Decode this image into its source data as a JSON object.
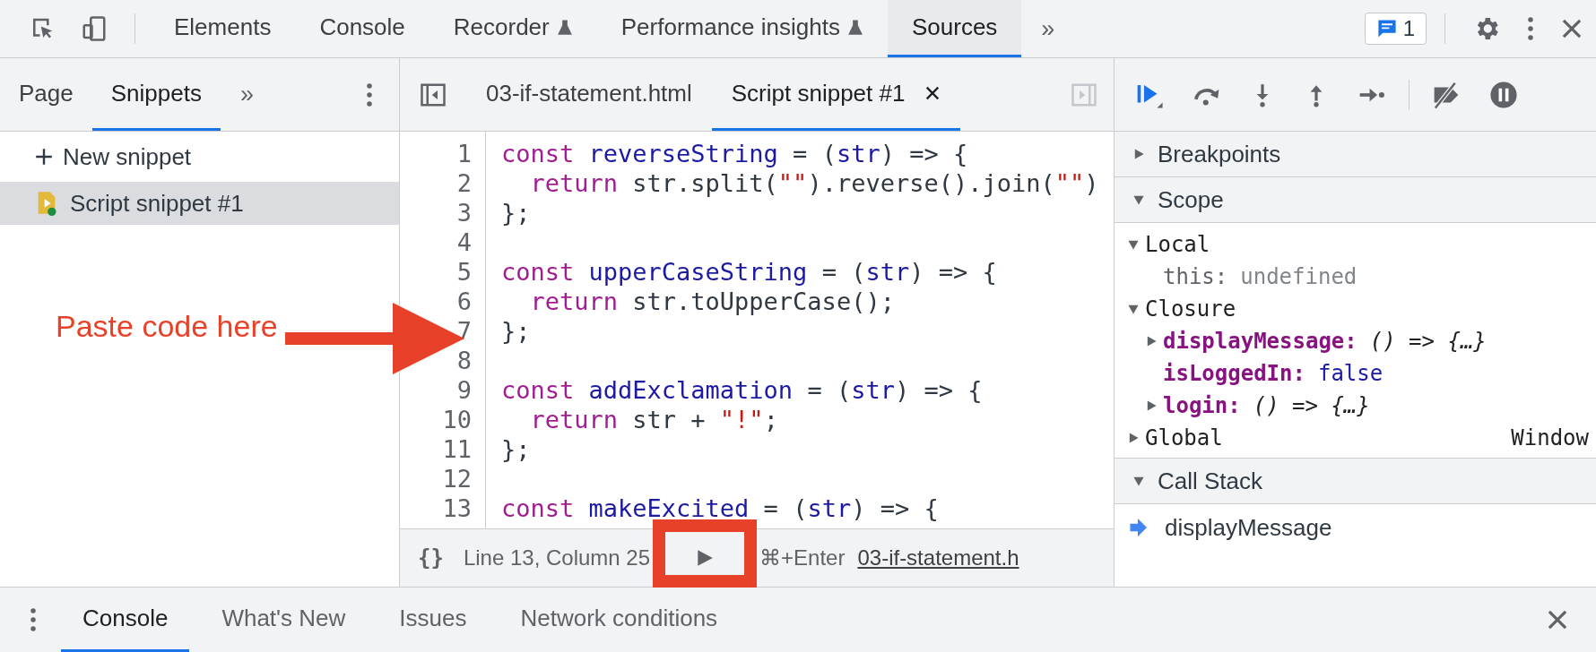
{
  "toolbar": {
    "tabs": [
      {
        "label": "Elements",
        "selected": false,
        "experimental": false
      },
      {
        "label": "Console",
        "selected": false,
        "experimental": false
      },
      {
        "label": "Recorder",
        "selected": false,
        "experimental": true
      },
      {
        "label": "Performance insights",
        "selected": false,
        "experimental": true
      },
      {
        "label": "Sources",
        "selected": true,
        "experimental": false
      }
    ],
    "more": "»",
    "issues_count": "1"
  },
  "navigator": {
    "tabs": [
      {
        "label": "Page",
        "selected": false
      },
      {
        "label": "Snippets",
        "selected": true
      }
    ],
    "more": "»",
    "new_snippet": "New snippet",
    "items": [
      {
        "label": "Script snippet #1",
        "selected": true
      }
    ]
  },
  "editor": {
    "tabs": [
      {
        "label": "03-if-statement.html",
        "selected": false,
        "closable": false
      },
      {
        "label": "Script snippet #1",
        "selected": true,
        "closable": true
      }
    ],
    "lines": [
      {
        "number": "1",
        "tokens": [
          {
            "kind": "keyword",
            "text": "const"
          },
          {
            "kind": "name",
            "text": " reverseString"
          },
          {
            "kind": "plain",
            "text": " = ("
          },
          {
            "kind": "name",
            "text": "str"
          },
          {
            "kind": "plain",
            "text": ") => {"
          }
        ]
      },
      {
        "number": "2",
        "indented": true,
        "tokens": [
          {
            "kind": "keyword",
            "text": "return"
          },
          {
            "kind": "plain",
            "text": " str.split("
          },
          {
            "kind": "string",
            "text": "\"\""
          },
          {
            "kind": "plain",
            "text": ").reverse().join("
          },
          {
            "kind": "string",
            "text": "\"\""
          },
          {
            "kind": "plain",
            "text": ")"
          }
        ]
      },
      {
        "number": "3",
        "tokens": [
          {
            "kind": "plain",
            "text": "};"
          }
        ]
      },
      {
        "number": "4"
      },
      {
        "number": "5",
        "tokens": [
          {
            "kind": "keyword",
            "text": "const"
          },
          {
            "kind": "name",
            "text": " upperCaseString"
          },
          {
            "kind": "plain",
            "text": " = ("
          },
          {
            "kind": "name",
            "text": "str"
          },
          {
            "kind": "plain",
            "text": ") => {"
          }
        ]
      },
      {
        "number": "6",
        "indented": true,
        "tokens": [
          {
            "kind": "keyword",
            "text": "return"
          },
          {
            "kind": "plain",
            "text": " str.toUpperCase();"
          }
        ]
      },
      {
        "number": "7",
        "tokens": [
          {
            "kind": "plain",
            "text": "};"
          }
        ]
      },
      {
        "number": "8"
      },
      {
        "number": "9",
        "tokens": [
          {
            "kind": "keyword",
            "text": "const"
          },
          {
            "kind": "name",
            "text": " addExclamation"
          },
          {
            "kind": "plain",
            "text": " = ("
          },
          {
            "kind": "name",
            "text": "str"
          },
          {
            "kind": "plain",
            "text": ") => {"
          }
        ]
      },
      {
        "number": "10",
        "indented": true,
        "tokens": [
          {
            "kind": "keyword",
            "text": "return"
          },
          {
            "kind": "plain",
            "text": " str + "
          },
          {
            "kind": "string",
            "text": "\"!\""
          },
          {
            "kind": "plain",
            "text": ";"
          }
        ]
      },
      {
        "number": "11",
        "tokens": [
          {
            "kind": "plain",
            "text": "};"
          }
        ]
      },
      {
        "number": "12"
      },
      {
        "number": "13",
        "tokens": [
          {
            "kind": "keyword",
            "text": "const"
          },
          {
            "kind": "name",
            "text": " makeExcited"
          },
          {
            "kind": "plain",
            "text": " = ("
          },
          {
            "kind": "name",
            "text": "str"
          },
          {
            "kind": "plain",
            "text": ") => {"
          }
        ]
      }
    ],
    "status_bar": {
      "format": "{}",
      "position": "Line 13, Column 25",
      "shortcut": "⌘+Enter",
      "file_link": "03-if-statement.h"
    }
  },
  "debugger": {
    "sections": [
      {
        "title": "Breakpoints",
        "expanded": false
      },
      {
        "title": "Scope",
        "expanded": true,
        "tree": [
          {
            "name": "Local",
            "kind": "scope",
            "expanded": true,
            "children": [
              {
                "name": "this:",
                "kind": "plain_property",
                "value": {
                  "kind": "undefined",
                  "text": "undefined"
                }
              }
            ]
          },
          {
            "name": "Closure",
            "kind": "scope",
            "expanded": true,
            "children": [
              {
                "name": "displayMessage:",
                "kind": "property",
                "value": {
                  "kind": "function",
                  "text": "() => {…}"
                },
                "expanded": false
              },
              {
                "name": "isLoggedIn:",
                "kind": "property",
                "value": {
                  "kind": "boolean",
                  "text": "false"
                }
              },
              {
                "name": "login:",
                "kind": "property",
                "value": {
                  "kind": "function",
                  "text": "() => {…}"
                },
                "expanded": false
              }
            ]
          },
          {
            "name": "Global",
            "kind": "scope",
            "value": {
              "kind": "object",
              "text": "Window"
            },
            "expanded": false
          }
        ]
      },
      {
        "title": "Call Stack",
        "expanded": true,
        "frames": [
          {
            "name": "displayMessage",
            "current": true
          }
        ]
      }
    ]
  },
  "drawer": {
    "tabs": [
      {
        "label": "Console",
        "selected": true
      },
      {
        "label": "What's New",
        "selected": false
      },
      {
        "label": "Issues",
        "selected": false
      },
      {
        "label": "Network conditions",
        "selected": false
      }
    ]
  },
  "annotation": {
    "label": "Paste code here"
  }
}
